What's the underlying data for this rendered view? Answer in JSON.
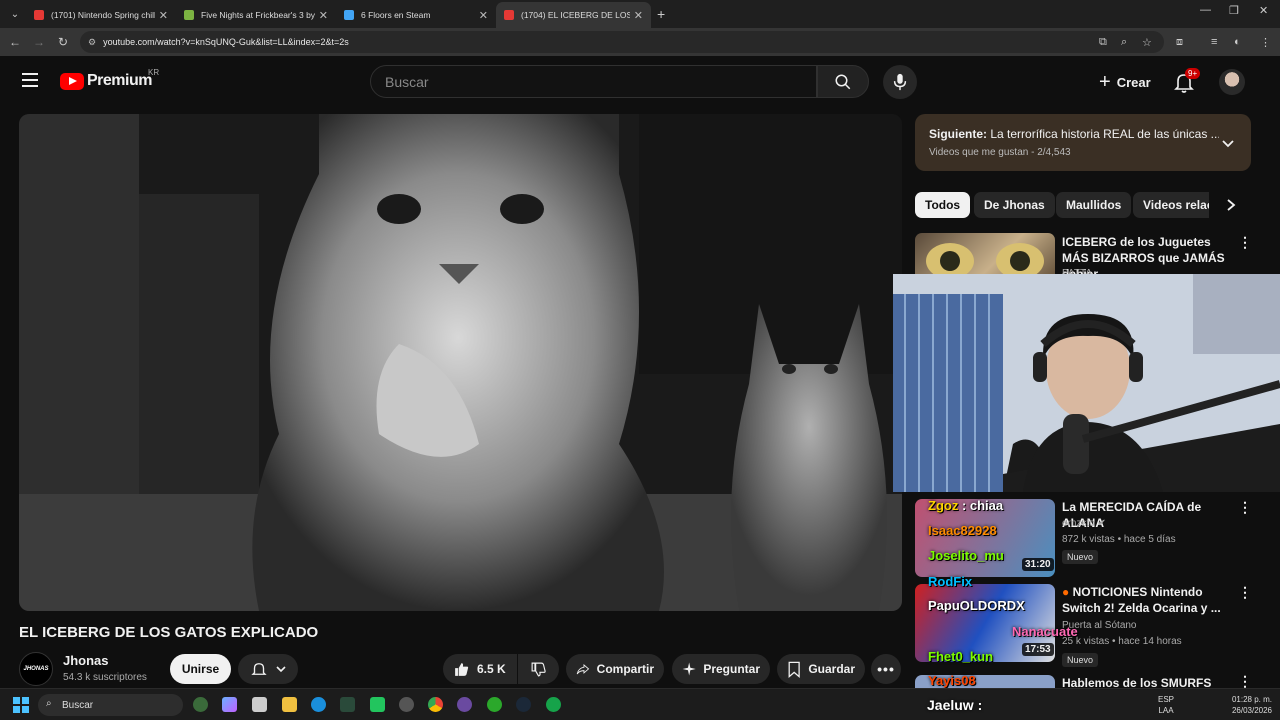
{
  "browser": {
    "tabs": [
      {
        "label": "(1701) Nintendo Spring chill m",
        "favicon_color": "#e53935",
        "active": false
      },
      {
        "label": "Five Nights at Frickbear's 3 by S",
        "favicon_color": "#7cb342",
        "active": false
      },
      {
        "label": "6 Floors en Steam",
        "favicon_color": "#42a5f5",
        "active": false
      },
      {
        "label": "(1704) EL ICEBERG DE LOS GAT",
        "favicon_color": "#e53935",
        "active": true
      }
    ],
    "url": "youtube.com/watch?v=knSqUNQ-Guk&list=LL&index=2&t=2s"
  },
  "header": {
    "logo_text": "Premium",
    "region": "KR",
    "search_placeholder": "Buscar",
    "create_label": "Crear",
    "notif_badge": "9+"
  },
  "video": {
    "title": "EL ICEBERG DE LOS GATOS EXPLICADO",
    "channel_name": "Jhonas",
    "channel_logo_text": "JHONAS",
    "subscribers": "54.3 k suscriptores",
    "join_label": "Unirse",
    "likes": "6.5 K",
    "share_label": "Compartir",
    "ask_label": "Preguntar",
    "save_label": "Guardar"
  },
  "playlist": {
    "next_prefix": "Siguiente:",
    "next_title": "La terrorífica historia REAL de las únicas ...",
    "subtitle": "Videos que me gustan - 2/4,543"
  },
  "chips": [
    "Todos",
    "De Jhonas",
    "Maullidos",
    "Videos relac"
  ],
  "recommendations": [
    {
      "title": "ICEBERG de los Juguetes MÁS BIZARROS que JAMÁS debier...",
      "channel": "PATTA",
      "meta": "",
      "duration": "",
      "badge": ""
    },
    {
      "title": "La MERECIDA CAÍDA de ALANA",
      "channel": "ernzsto",
      "meta": "872 k vistas • hace 5 días",
      "duration": "31:20",
      "badge": "Nuevo"
    },
    {
      "title": "NOTICIONES Nintendo Switch 2! Zelda Ocarina y ...",
      "channel": "Puerta al Sótano",
      "meta": "25 k vistas • hace 14 horas",
      "duration": "17:53",
      "badge": "Nuevo"
    },
    {
      "title": "Hablemos de los SMURFS",
      "channel": "",
      "meta": "",
      "duration": "",
      "badge": ""
    }
  ],
  "overlay_chat": [
    {
      "name": "Zgoz",
      "text": "chiaa",
      "color": "#ffd400"
    },
    {
      "name": "Isaac82928",
      "text": "",
      "color": "#ff8c00"
    },
    {
      "name": "Joselito_mu",
      "text": "",
      "color": "#7cfc00"
    },
    {
      "name": "RodFix",
      "text": "",
      "color": "#00bfff"
    },
    {
      "name": "PapuOLDORDX",
      "text": "",
      "color": "#ffffff"
    },
    {
      "name": "Nanacuate",
      "text": "",
      "color": "#ff69b4"
    },
    {
      "name": "Fhet0_kun",
      "text": "",
      "color": "#7cfc00"
    },
    {
      "name": "Yayis08",
      "text": "",
      "color": "#ff4500"
    }
  ],
  "overlay_bottom": "Jaeluw :",
  "taskbar": {
    "search_label": "Buscar",
    "lang": "ESP",
    "lang2": "LAA",
    "time": "01:28 p. m.",
    "date": "26/03/2026"
  }
}
